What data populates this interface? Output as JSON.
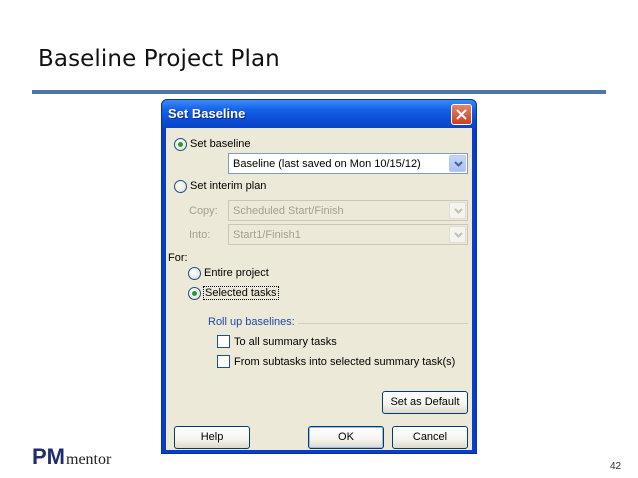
{
  "slide": {
    "title": "Baseline Project Plan",
    "page_number": "42"
  },
  "logo": {
    "pm": "PM",
    "mentor": "mentor"
  },
  "dialog": {
    "title": "Set Baseline",
    "set_baseline_label": "Set baseline",
    "baseline_select_value": "Baseline (last saved on Mon 10/15/12)",
    "set_interim_label": "Set interim plan",
    "copy_label": "Copy:",
    "copy_value": "Scheduled Start/Finish",
    "into_label": "Into:",
    "into_value": "Start1/Finish1",
    "for_label": "For:",
    "entire_project_label": "Entire project",
    "selected_tasks_label": "Selected tasks",
    "rollup_label": "Roll up baselines:",
    "to_all_summary_label": "To all summary tasks",
    "from_subtasks_label": "From subtasks into selected summary task(s)",
    "set_default_label": "Set as Default",
    "help_label": "Help",
    "ok_label": "OK",
    "cancel_label": "Cancel"
  },
  "colors": {
    "title_rule": "#4f76a8",
    "titlebar": "#0a4ed6",
    "rollup_text": "#1c4aa8"
  }
}
